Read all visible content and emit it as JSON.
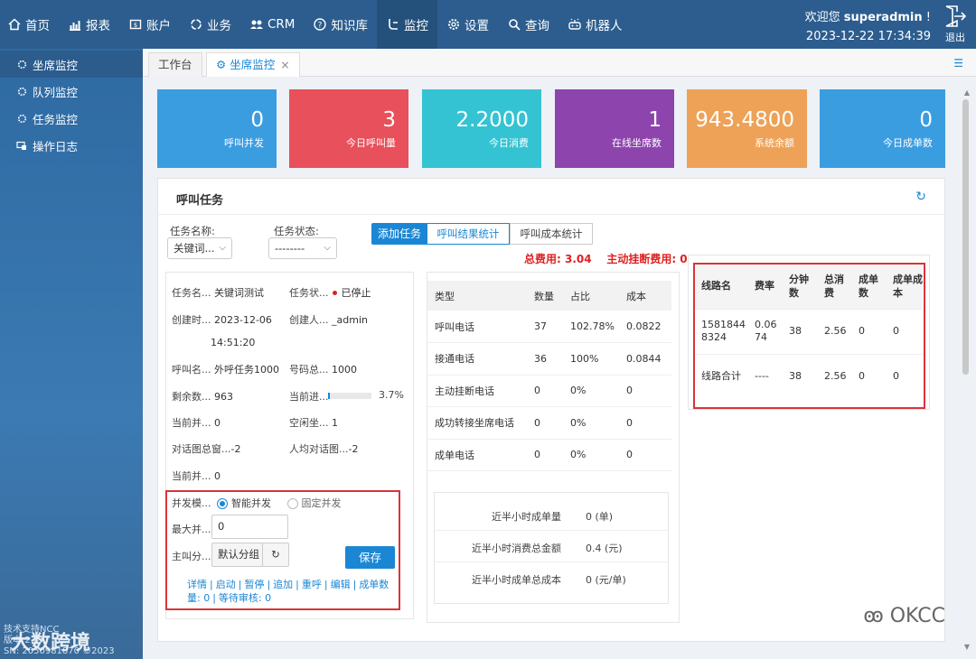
{
  "nav": {
    "items": [
      {
        "label": "首页",
        "icon": "home-icon"
      },
      {
        "label": "报表",
        "icon": "chart-icon"
      },
      {
        "label": "账户",
        "icon": "account-icon"
      },
      {
        "label": "业务",
        "icon": "business-icon"
      },
      {
        "label": "CRM",
        "icon": "crm-icon"
      },
      {
        "label": "知识库",
        "icon": "help-icon"
      },
      {
        "label": "监控",
        "icon": "monitor-icon"
      },
      {
        "label": "设置",
        "icon": "gear-icon"
      },
      {
        "label": "查询",
        "icon": "search-icon"
      },
      {
        "label": "机器人",
        "icon": "robot-icon"
      }
    ],
    "active": "监控",
    "welcome_prefix": "欢迎您 ",
    "username": "superadmin",
    "welcome_suffix": " !",
    "datetime": "2023-12-22 17:34:39",
    "logout": "退出"
  },
  "sidebar": {
    "items": [
      {
        "label": "坐席监控"
      },
      {
        "label": "队列监控"
      },
      {
        "label": "任务监控"
      },
      {
        "label": "操作日志"
      }
    ],
    "footer_line1": "技术支持NCC",
    "footer_line2": "版本:2.4",
    "footer_line3": "SN: 2050981870  ©2023"
  },
  "tabs": [
    {
      "label": "工作台"
    },
    {
      "label": "坐席监控"
    }
  ],
  "stats": [
    {
      "value": "0",
      "label": "呼叫并发",
      "color": "#3a9de0"
    },
    {
      "value": "3",
      "label": "今日呼叫量",
      "color": "#e8505b"
    },
    {
      "value": "2.2000",
      "label": "今日消费",
      "color": "#34c3d2"
    },
    {
      "value": "1",
      "label": "在线坐席数",
      "color": "#8e44ad"
    },
    {
      "value": "943.4800",
      "label": "系统余额",
      "color": "#eda257"
    },
    {
      "value": "0",
      "label": "今日成单数",
      "color": "#3a9de0"
    }
  ],
  "panel": {
    "title": "呼叫任务",
    "filters": {
      "task_name_label": "任务名称:",
      "task_name_value": "关键词...",
      "task_status_label": "任务状态:",
      "task_status_value": "--------"
    },
    "buttons": {
      "add_task": "添加任务",
      "call_result_stats": "呼叫结果统计",
      "call_cost_stats": "呼叫成本统计"
    },
    "total_cost": "总费用: 3.04",
    "hangup_cost": "主动挂断费用: 0"
  },
  "task": {
    "name_k": "任务名...",
    "name_v": "关键词测试",
    "status_k": "任务状...",
    "status_v": "已停止",
    "created_k": "创建时...",
    "created_v1": "2023-12-06",
    "created_v2": "14:51:20",
    "creator_k": "创建人...",
    "creator_v": "_admin",
    "callname_k": "呼叫名...",
    "callname_v": "外呼任务1000",
    "numtotal_k": "号码总...",
    "numtotal_v": "1000",
    "remain_k": "剩余数...",
    "remain_v": "963",
    "progress_k": "当前进...",
    "progress_v": "3.7%",
    "progress_fraction": 0.037,
    "cur1_k": "当前并...",
    "cur1_v": "0",
    "idle_k": "空闲坐...",
    "idle_v": "1",
    "dialog_k": "对话图总窗...",
    "dialog_v": "-2",
    "avg_k": "人均对话图...",
    "avg_v": "-2",
    "cur2_k": "当前并...",
    "cur2_v": "0",
    "mode_k": "并发模...",
    "mode_smart": "智能并发",
    "mode_fixed": "固定并发",
    "max_k": "最大并...",
    "max_v": "0",
    "group_k": "主叫分...",
    "group_v": "默认分组",
    "save": "保存",
    "links": [
      "详情",
      "启动",
      "暂停",
      "追加",
      "重呼",
      "编辑",
      "成单数量: 0",
      "等待审核: 0"
    ]
  },
  "call_stats": {
    "headers": [
      "类型",
      "数量",
      "占比",
      "成本"
    ],
    "rows": [
      [
        "呼叫电话",
        "37",
        "102.78%",
        "0.0822"
      ],
      [
        "接通电话",
        "36",
        "100%",
        "0.0844"
      ],
      [
        "主动挂断电话",
        "0",
        "0%",
        "0"
      ],
      [
        "成功转接坐席电话",
        "0",
        "0%",
        "0"
      ],
      [
        "成单电话",
        "0",
        "0%",
        "0"
      ]
    ]
  },
  "half_hour": [
    {
      "k": "近半小时成单量",
      "v": "0 (单)"
    },
    {
      "k": "近半小时消费总金额",
      "v": "0.4 (元)"
    },
    {
      "k": "近半小时成单总成本",
      "v": "0 (元/单)"
    }
  ],
  "line_table": {
    "headers": [
      "线路名",
      "费率",
      "分钟数",
      "总消费",
      "成单数",
      "成单成本"
    ],
    "rows": [
      [
        "15818448324",
        "0.0674",
        "38",
        "2.56",
        "0",
        "0"
      ],
      [
        "线路合计",
        "----",
        "38",
        "2.56",
        "0",
        "0"
      ]
    ]
  },
  "watermark": "OKCC",
  "watermark_left": "大数跨境"
}
